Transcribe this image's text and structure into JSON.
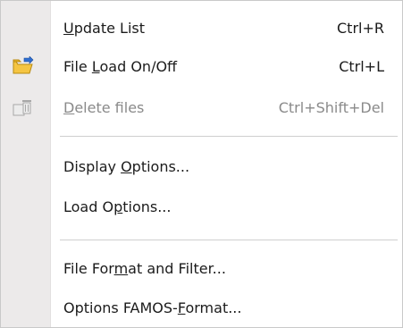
{
  "menu": {
    "items": [
      {
        "pre": "",
        "key": "U",
        "post": "pdate List",
        "shortcut": "Ctrl+R",
        "disabled": false,
        "icon": null
      },
      {
        "pre": "File ",
        "key": "L",
        "post": "oad On/Off",
        "shortcut": "Ctrl+L",
        "disabled": false,
        "icon": "folder-load-icon"
      },
      {
        "pre": "",
        "key": "D",
        "post": "elete files",
        "shortcut": "Ctrl+Shift+Del",
        "disabled": true,
        "icon": "delete-files-icon"
      },
      {
        "pre": "Display ",
        "key": "O",
        "post": "ptions...",
        "shortcut": "",
        "disabled": false,
        "icon": null
      },
      {
        "pre": "Load O",
        "key": "p",
        "post": "tions...",
        "shortcut": "",
        "disabled": false,
        "icon": null
      },
      {
        "pre": "File For",
        "key": "m",
        "post": "at and Filter...",
        "shortcut": "",
        "disabled": false,
        "icon": null
      },
      {
        "pre": "Options FAMOS-",
        "key": "F",
        "post": "ormat...",
        "shortcut": "",
        "disabled": false,
        "icon": null
      }
    ]
  },
  "colors": {
    "gutter": "#eceaea",
    "text": "#1b1b1b",
    "disabled_text": "#8a8a8a",
    "separator": "#cfcfcf",
    "folder_icon": "#f2b927"
  }
}
